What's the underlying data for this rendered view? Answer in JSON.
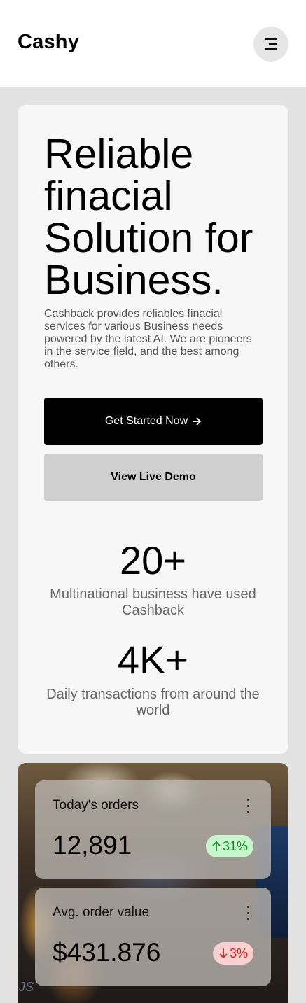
{
  "header": {
    "brand": "Cashy",
    "menu_icon": "menu-icon"
  },
  "hero": {
    "title": "Reliable finacial Solution for Business.",
    "description": "Cashback provides reliables finacial services for various Business needs powered by the latest AI. We are pioneers in the service field, and the best among others.",
    "primary_button": "Get Started Now",
    "primary_button_icon": "arrow-right-icon",
    "secondary_button": "View Live Demo"
  },
  "stats": [
    {
      "value": "20+",
      "label": "Multinational business have used Cashback"
    },
    {
      "value": "4K+",
      "label": "Daily transactions from around the world"
    }
  ],
  "widgets": [
    {
      "title": "Today's orders",
      "value": "12,891",
      "change": "31%",
      "direction": "up",
      "color": "#178a2a"
    },
    {
      "title": "Avg. order value",
      "value": "$431.876",
      "change": "3%",
      "direction": "down",
      "color": "#d42020"
    }
  ],
  "colors": {
    "background": "#e2e2e2",
    "primary_button": "#000000",
    "secondary_button": "#cfcfcf",
    "badge_up": "#c9f5cc",
    "badge_down": "#fbd0d0"
  },
  "watermark": "JS"
}
